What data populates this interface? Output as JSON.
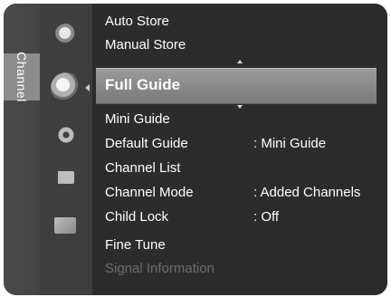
{
  "category": {
    "label": "Channel"
  },
  "icons": [
    "antenna-icon",
    "channel-icon",
    "setup-icon",
    "input-icon",
    "application-icon"
  ],
  "menu": {
    "selected": "Full Guide",
    "items": [
      {
        "label": "Auto Store",
        "value": ""
      },
      {
        "label": "Manual Store",
        "value": ""
      },
      {
        "label": "Mini Guide",
        "value": ""
      },
      {
        "label": "Default Guide",
        "value": ": Mini Guide"
      },
      {
        "label": "Channel List",
        "value": ""
      },
      {
        "label": "Channel Mode",
        "value": ": Added Channels"
      },
      {
        "label": "Child Lock",
        "value": ": Off"
      },
      {
        "label": "Fine Tune",
        "value": ""
      },
      {
        "label": "Signal Information",
        "value": ""
      }
    ]
  },
  "colors": {
    "panel": "#3b3b3b",
    "menu_bg": "#2c2c2c",
    "highlight": "#8a8a8a",
    "text": "#ffffff",
    "disabled_text": "#6d6d6d"
  }
}
